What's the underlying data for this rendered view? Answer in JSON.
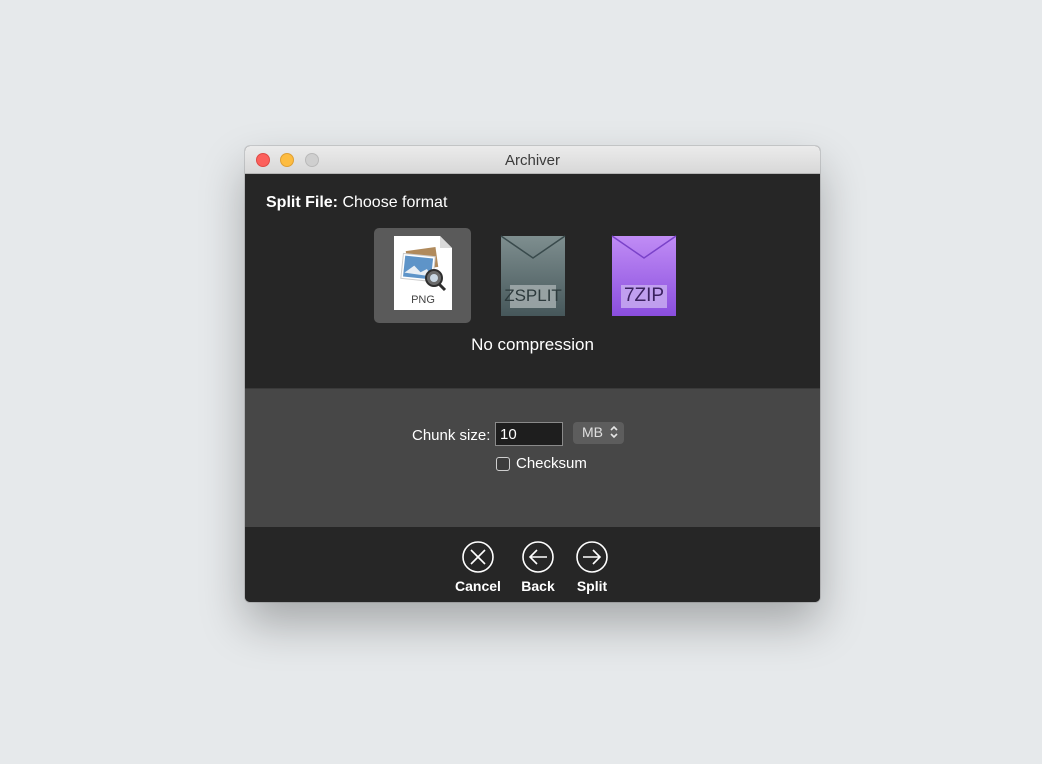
{
  "window": {
    "title": "Archiver"
  },
  "header": {
    "prefix": "Split File:",
    "text": "Choose format"
  },
  "formats": [
    {
      "label": "PNG",
      "icon": "png-file-icon",
      "selected": true
    },
    {
      "label": "ZSPLIT",
      "icon": "zsplit-archive-icon",
      "selected": false
    },
    {
      "label": "7ZIP",
      "icon": "7zip-archive-icon",
      "selected": false
    }
  ],
  "format_description": "No compression",
  "options": {
    "chunk_label": "Chunk size:",
    "chunk_value": "10",
    "unit": "MB",
    "checksum_label": "Checksum",
    "checksum_checked": false
  },
  "actions": {
    "cancel": "Cancel",
    "back": "Back",
    "split": "Split"
  },
  "colors": {
    "close": "#fc605c",
    "minimize": "#fdbc40",
    "zoom": "#cfcfcf",
    "panel_dark": "#262626",
    "panel_mid": "#474747",
    "zsplit": "#5d6d6e",
    "sevenzip": "#9b5ae8"
  }
}
